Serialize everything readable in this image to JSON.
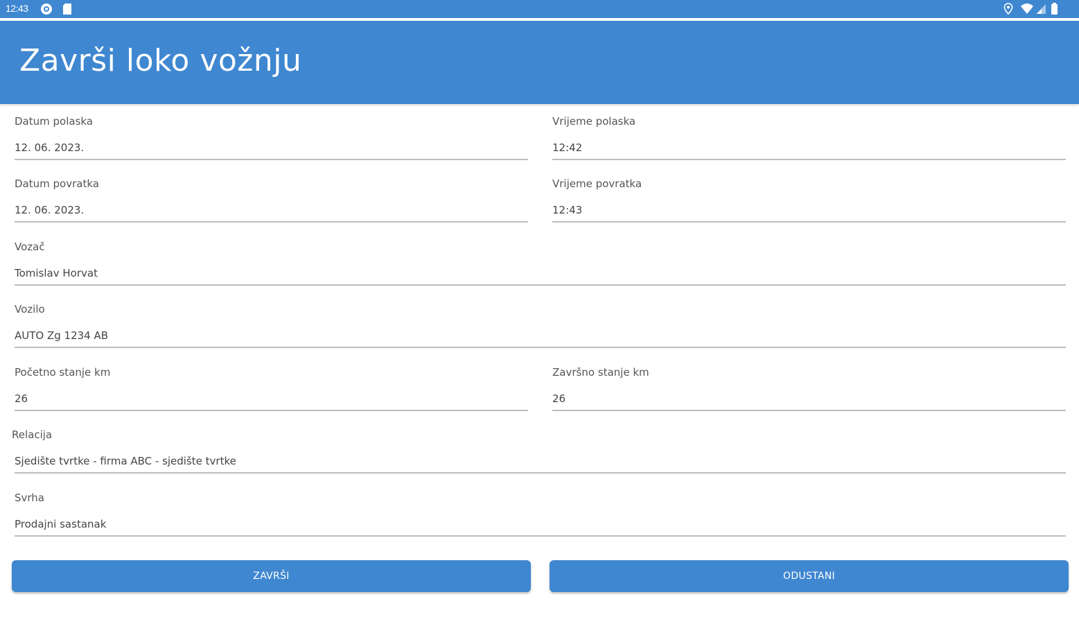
{
  "status_bar": {
    "time": "12:43",
    "icons_left": [
      "notification-icon",
      "sd-card-icon"
    ],
    "icons_right": [
      "location-icon",
      "wifi-icon",
      "signal-icon",
      "battery-icon"
    ]
  },
  "app_bar": {
    "title": "Završi loko vožnju"
  },
  "form": {
    "datum_polaska": {
      "label": "Datum polaska",
      "value": "12. 06. 2023."
    },
    "vrijeme_polaska": {
      "label": "Vrijeme polaska",
      "value": "12:42"
    },
    "datum_povratka": {
      "label": "Datum povratka",
      "value": "12. 06. 2023."
    },
    "vrijeme_povratka": {
      "label": "Vrijeme povratka",
      "value": "12:43"
    },
    "vozac": {
      "label": "Vozač",
      "value": "Tomislav Horvat"
    },
    "vozilo": {
      "label": "Vozilo",
      "value": "AUTO Zg 1234 AB"
    },
    "pocetno_stanje": {
      "label": "Početno stanje km",
      "value": "26"
    },
    "zavrsno_stanje": {
      "label": "Završno stanje km",
      "value": "26"
    },
    "relacija": {
      "label": "Relacija",
      "value": "Sjedište tvrtke - firma ABC - sjedište tvrtke"
    },
    "svrha": {
      "label": "Svrha",
      "value": "Prodajni sastanak"
    }
  },
  "buttons": {
    "zavrsi": "ZAVRŠI",
    "odustani": "ODUSTANI"
  },
  "colors": {
    "primary": "#3f87d0",
    "underline": "#bdbdbd",
    "label_text": "#555555",
    "value_text": "#444444"
  }
}
